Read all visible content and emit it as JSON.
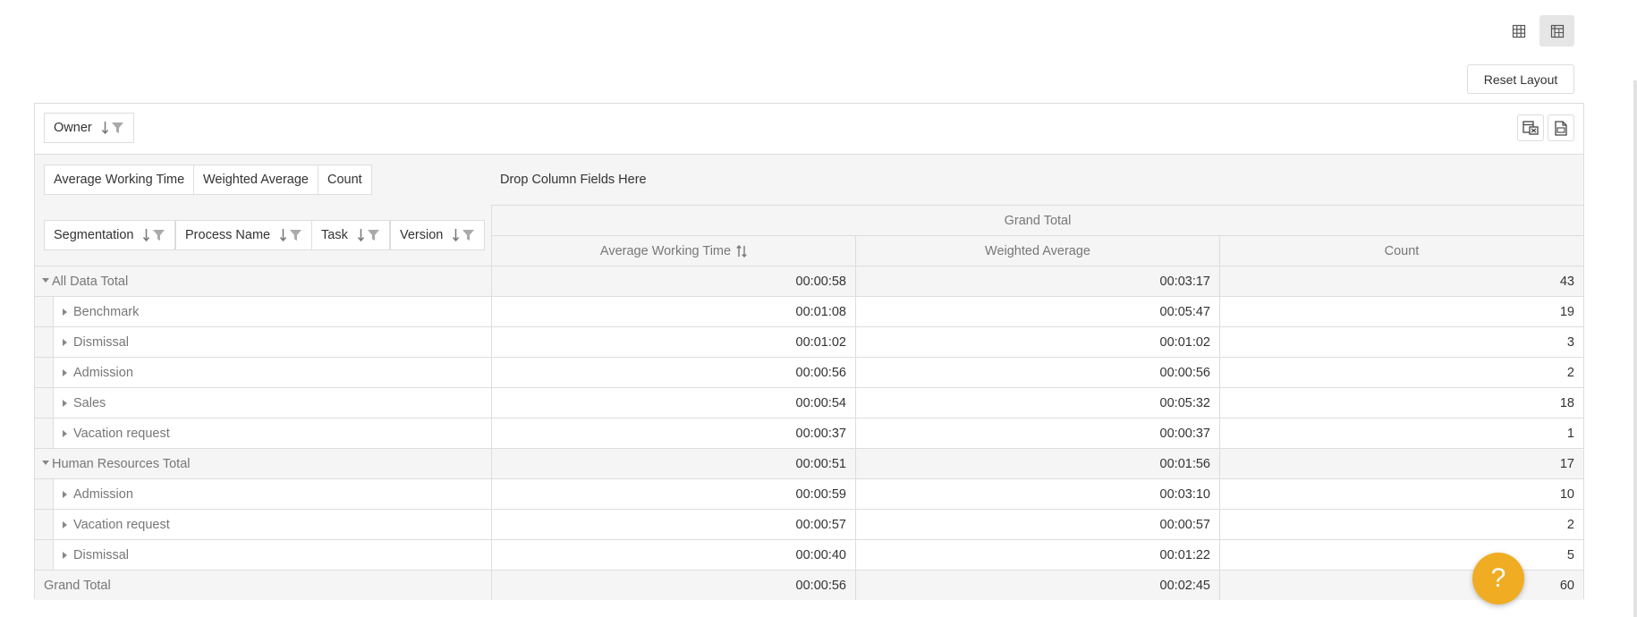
{
  "toolbar": {
    "view_icons": [
      "grid-view-icon",
      "pivot-view-icon"
    ],
    "reset_label": "Reset Layout"
  },
  "pivot": {
    "filter_fields": [
      {
        "label": "Owner"
      }
    ],
    "data_fields": [
      {
        "label": "Average Working Time"
      },
      {
        "label": "Weighted Average"
      },
      {
        "label": "Count"
      }
    ],
    "column_drop_placeholder": "Drop Column Fields Here",
    "row_fields": [
      {
        "label": "Segmentation"
      },
      {
        "label": "Process Name"
      },
      {
        "label": "Task"
      },
      {
        "label": "Version"
      }
    ],
    "grand_total_header": "Grand Total",
    "column_headers": [
      "Average Working Time",
      "Weighted Average",
      "Count"
    ],
    "rows": [
      {
        "label": "All Data Total",
        "type": "total",
        "values": [
          "00:00:58",
          "00:03:17",
          "43"
        ]
      },
      {
        "label": "Benchmark",
        "type": "child",
        "values": [
          "00:01:08",
          "00:05:47",
          "19"
        ]
      },
      {
        "label": "Dismissal",
        "type": "child",
        "values": [
          "00:01:02",
          "00:01:02",
          "3"
        ]
      },
      {
        "label": "Admission",
        "type": "child",
        "values": [
          "00:00:56",
          "00:00:56",
          "2"
        ]
      },
      {
        "label": "Sales",
        "type": "child",
        "values": [
          "00:00:54",
          "00:05:32",
          "18"
        ]
      },
      {
        "label": "Vacation request",
        "type": "child",
        "values": [
          "00:00:37",
          "00:00:37",
          "1"
        ]
      },
      {
        "label": "Human Resources Total",
        "type": "total",
        "values": [
          "00:00:51",
          "00:01:56",
          "17"
        ]
      },
      {
        "label": "Admission",
        "type": "child",
        "values": [
          "00:00:59",
          "00:03:10",
          "10"
        ]
      },
      {
        "label": "Vacation request",
        "type": "child",
        "values": [
          "00:00:57",
          "00:00:57",
          "2"
        ]
      },
      {
        "label": "Dismissal",
        "type": "child",
        "values": [
          "00:00:40",
          "00:01:22",
          "5"
        ]
      },
      {
        "label": "Grand Total",
        "type": "grand",
        "values": [
          "00:00:56",
          "00:02:45",
          "60"
        ]
      }
    ]
  },
  "help": {
    "label": "?"
  },
  "colors": {
    "accent": "#f0ad23",
    "border": "#dddddd",
    "muted_text": "#777777"
  }
}
